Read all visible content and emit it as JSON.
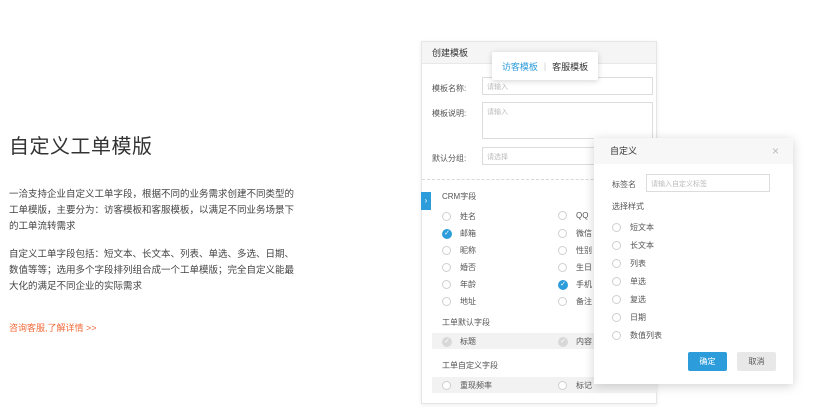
{
  "promo": {
    "title": "自定义工单模版",
    "para1": "一洽支持企业自定义工单字段，根据不同的业务需求创建不同类型的工单模版，主要分为：访客模板和客服模板，以满足不同业务场景下的工单流转需求",
    "para2": "自定义工单字段包括：短文本、长文本、列表、单选、多选、日期、数值等等；选用多个字段排列组合成一个工单模版；完全自定义能最大化的满足不同企业的实际需求",
    "link": "咨询客服,了解详情 >>"
  },
  "card": {
    "title": "创建模板",
    "name_label": "模板名称:",
    "name_placeholder": "请输入",
    "desc_label": "模板说明:",
    "desc_placeholder": "请输入",
    "group_label": "默认分组:",
    "group_placeholder": "请选择",
    "crm_title": "CRM字段",
    "crm_left": [
      "姓名",
      "邮箱",
      "昵称",
      "婚否",
      "年龄",
      "地址"
    ],
    "crm_right": [
      "QQ",
      "微信",
      "性别",
      "生日",
      "手机",
      "备注"
    ],
    "default_title": "工单默认字段",
    "default_fields": [
      "标题",
      "内容"
    ],
    "custom_title": "工单自定义字段",
    "custom_fields": [
      "重现频率",
      "标记"
    ]
  },
  "tabs": {
    "visitor": "访客模板",
    "agent": "客服模板"
  },
  "dialog": {
    "title": "自定义",
    "close": "×",
    "label_name": "标签名",
    "label_placeholder": "请输入自定义标签",
    "style_title": "选择样式",
    "options": [
      "短文本",
      "长文本",
      "列表",
      "单选",
      "复选",
      "日期",
      "数值列表"
    ],
    "ok": "确定",
    "cancel": "取消"
  },
  "colors": {
    "accent": "#2d9cdb",
    "link": "#f06a3a"
  }
}
